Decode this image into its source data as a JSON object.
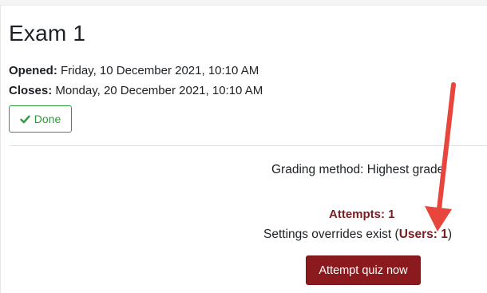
{
  "quiz": {
    "title": "Exam 1",
    "opened_label": "Opened:",
    "opened_value": " Friday, 10 December 2021, 10:10 AM",
    "closes_label": "Closes:",
    "closes_value": " Monday, 20 December 2021, 10:10 AM",
    "done_label": "Done"
  },
  "info": {
    "grading_method": "Grading method: Highest grade",
    "attempts_link": "Attempts: 1",
    "overrides_prefix": "Settings overrides exist (",
    "users_link": "Users: 1",
    "overrides_suffix": ")",
    "attempt_button": "Attempt quiz now"
  },
  "icons": {
    "done": "check-icon"
  },
  "colors": {
    "success": "#2e9a3c",
    "brand_dark_red": "#8b1a1e",
    "link_red": "#7a1c20",
    "annotation_arrow": "#e8453c"
  }
}
